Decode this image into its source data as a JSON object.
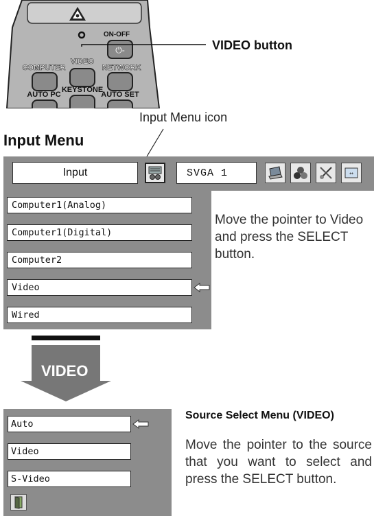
{
  "remote": {
    "buttons": [
      "ON-OFF",
      "COMPUTER",
      "VIDEO",
      "NETWORK",
      "AUTO PC",
      "KEYSTONE",
      "AUTO SET"
    ],
    "callout": "VIDEO button"
  },
  "input_menu_icon_label": "Input Menu icon",
  "input_menu_title": "Input Menu",
  "menubar": {
    "input_label": "Input",
    "display_value": "SVGA 1",
    "icons": [
      "input-menu-icon",
      "computer-icon",
      "color-balls-icon",
      "scissors-icon",
      "screen-icon"
    ]
  },
  "input_list": {
    "items": [
      "Computer1(Analog)",
      "Computer1(Digital)",
      "Computer2",
      "Video",
      "Wired"
    ],
    "selected_index": 3
  },
  "instruction1": "Move the pointer to Video and press the SELECT button.",
  "arrow_label": "VIDEO",
  "source_menu": {
    "title": "Source Select Menu (VIDEO)",
    "items": [
      "Auto",
      "Video",
      "S-Video"
    ],
    "selected_index": 0
  },
  "instruction2": "Move the pointer to the source that you want to select and press the SELECT button."
}
